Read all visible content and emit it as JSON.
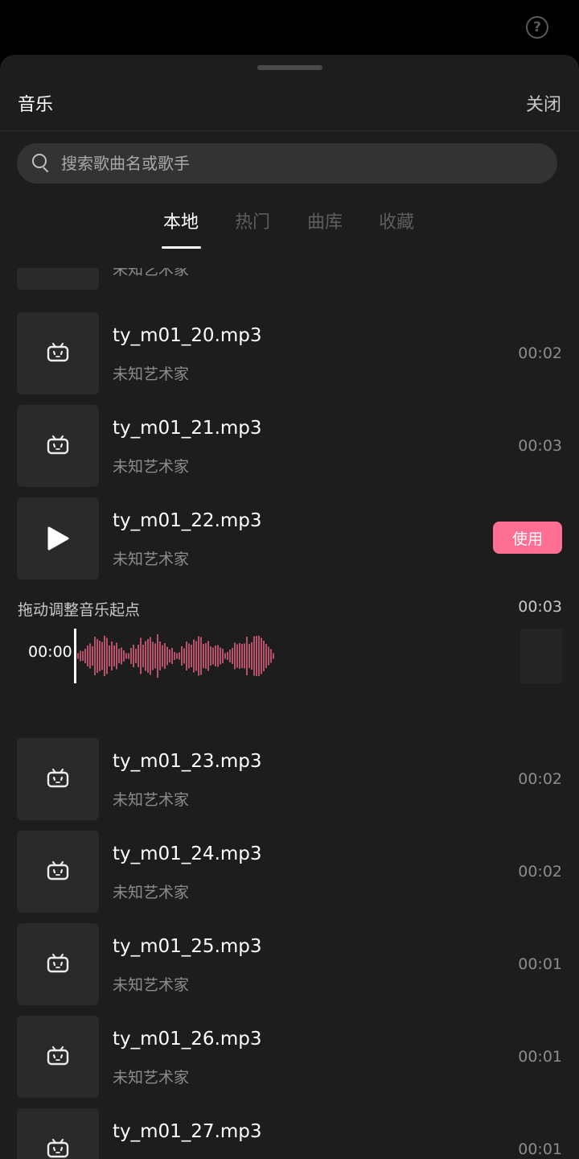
{
  "help": {
    "glyph": "?"
  },
  "sheet": {
    "title": "音乐",
    "close_label": "关闭"
  },
  "search": {
    "placeholder": "搜索歌曲名或歌手",
    "value": ""
  },
  "tabs": [
    {
      "label": "本地",
      "active": true
    },
    {
      "label": "热门",
      "active": false
    },
    {
      "label": "曲库",
      "active": false
    },
    {
      "label": "收藏",
      "active": false
    }
  ],
  "songs": [
    {
      "name": "",
      "artist": "未知艺术家",
      "duration": ""
    },
    {
      "name": "ty_m01_20.mp3",
      "artist": "未知艺术家",
      "duration": "00:02"
    },
    {
      "name": "ty_m01_21.mp3",
      "artist": "未知艺术家",
      "duration": "00:03"
    },
    {
      "name": "ty_m01_22.mp3",
      "artist": "未知艺术家",
      "duration": "",
      "use_label": "使用"
    },
    {
      "name": "ty_m01_23.mp3",
      "artist": "未知艺术家",
      "duration": "00:02"
    },
    {
      "name": "ty_m01_24.mp3",
      "artist": "未知艺术家",
      "duration": "00:02"
    },
    {
      "name": "ty_m01_25.mp3",
      "artist": "未知艺术家",
      "duration": "00:01"
    },
    {
      "name": "ty_m01_26.mp3",
      "artist": "未知艺术家",
      "duration": "00:01"
    },
    {
      "name": "ty_m01_27.mp3",
      "artist": "",
      "duration": "00:01"
    }
  ],
  "trim": {
    "label": "拖动调整音乐起点",
    "duration": "00:03",
    "start_time": "00:00"
  },
  "colors": {
    "accent": "#ff6f94",
    "waveform": "#e0607e",
    "background": "#1d1d1d"
  },
  "icons": {
    "thumb": "bilibili-tv-icon",
    "playing": "play-icon",
    "search": "search-icon",
    "help": "help-icon"
  }
}
